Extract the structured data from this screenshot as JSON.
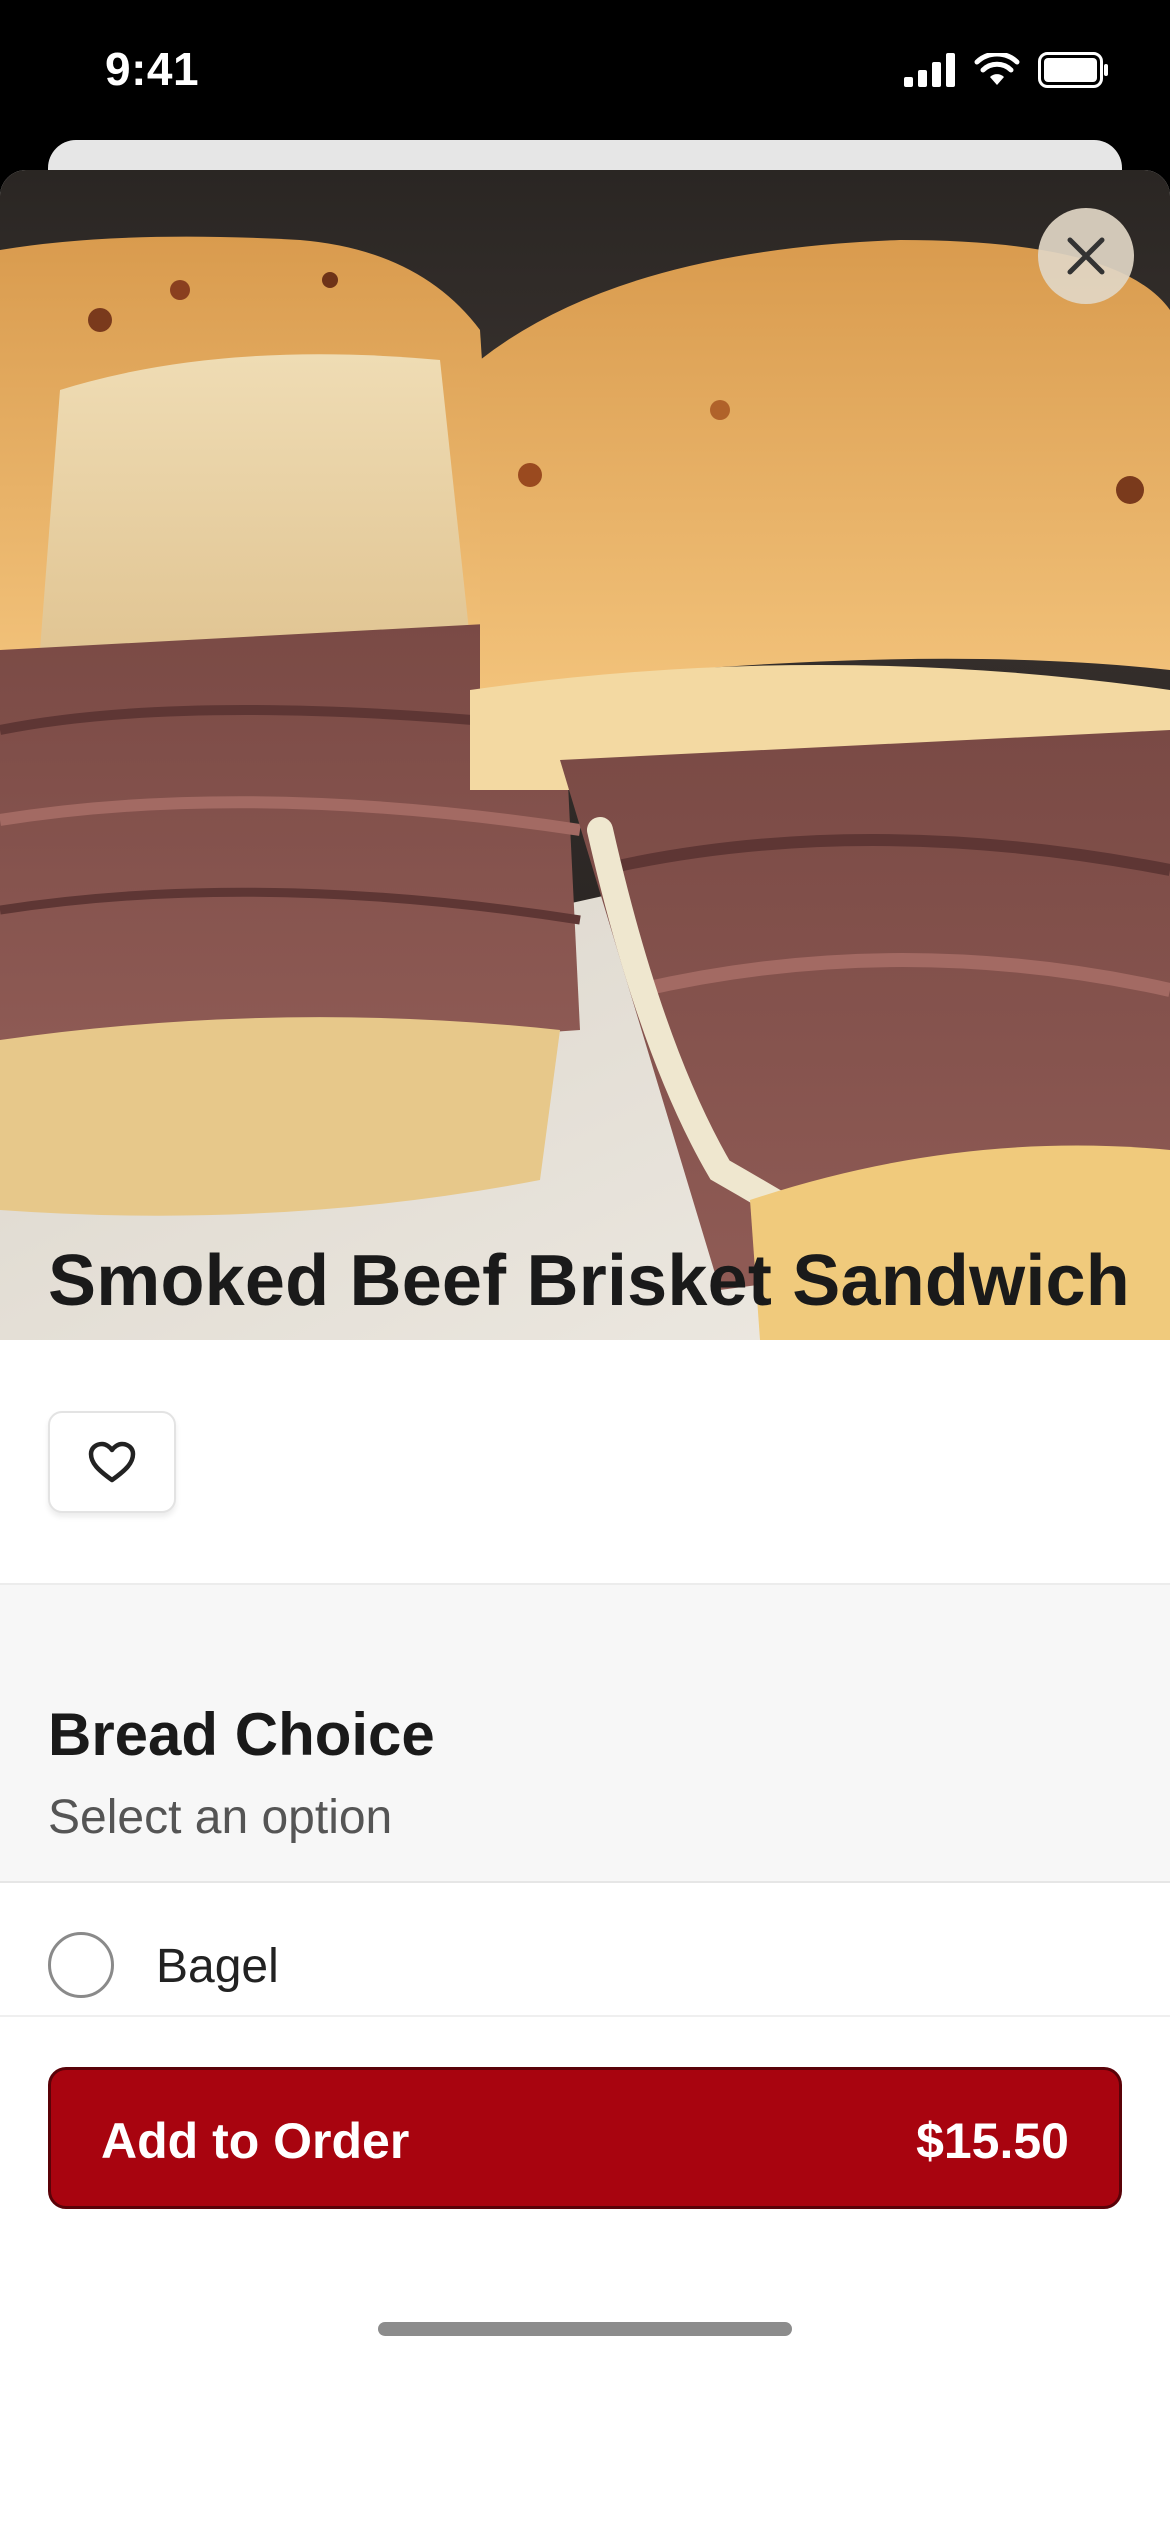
{
  "status_bar": {
    "time": "9:41"
  },
  "item": {
    "title": "Smoked Beef Brisket Sandwich"
  },
  "section": {
    "title": "Bread Choice",
    "subtitle": "Select an option",
    "options": [
      {
        "label": "Bagel",
        "selected": false
      }
    ]
  },
  "cta": {
    "label": "Add to Order",
    "price": "$15.50"
  },
  "icons": {
    "close": "close-icon",
    "favorite": "heart-icon",
    "signal": "cellular-signal-icon",
    "wifi": "wifi-icon",
    "battery": "battery-icon"
  },
  "colors": {
    "accent": "#a8040f"
  }
}
